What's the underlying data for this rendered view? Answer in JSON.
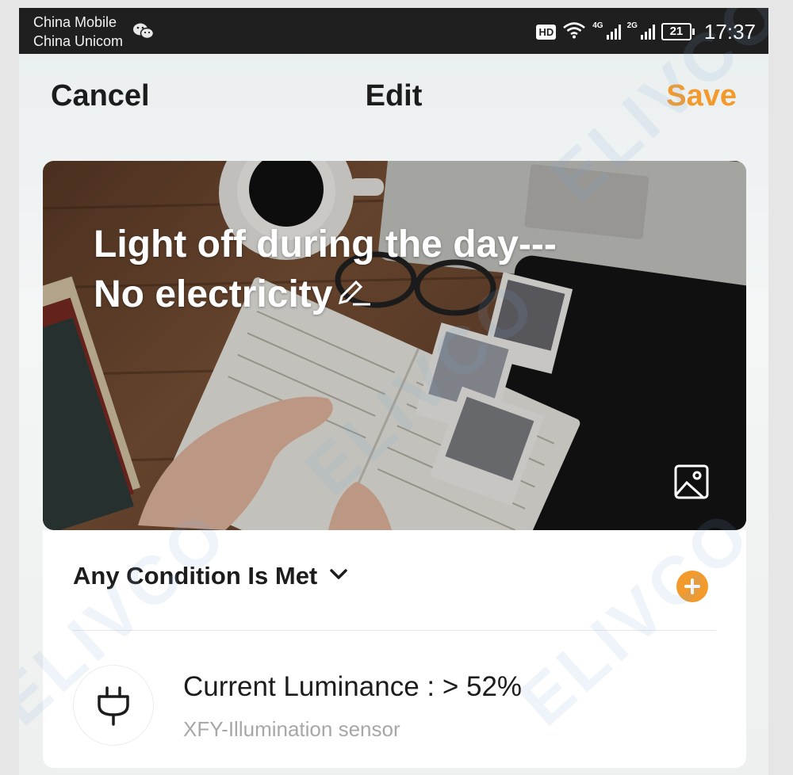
{
  "status_bar": {
    "carrier_1": "China Mobile",
    "carrier_2": "China Unicom",
    "hd": "HD",
    "net_1": "4G",
    "net_2": "2G",
    "battery": "21",
    "time": "17:37"
  },
  "nav": {
    "cancel": "Cancel",
    "title": "Edit",
    "save": "Save"
  },
  "scene": {
    "name_line_1": "Light off during the day---",
    "name_line_2": "No electricity"
  },
  "conditions": {
    "mode_label": "Any Condition Is Met",
    "items": [
      {
        "text": "Current Luminance : > 52%",
        "device": "XFY-Illumination sensor",
        "icon": "plug-icon"
      }
    ]
  },
  "colors": {
    "accent": "#f39a2c",
    "status_bar_bg": "#1f1f1f"
  },
  "watermark": "ELIVCO"
}
